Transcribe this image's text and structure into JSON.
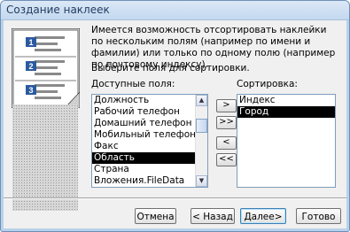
{
  "window": {
    "title": "Создание наклеек"
  },
  "description": "Имеется возможность отсортировать наклейки по нескольким полям (например по имени и фамилии) или только по одному полю (например по почтовому индексу).",
  "prompt": "Выберите поля для сортировки.",
  "available_fields": {
    "label": "Доступные поля:",
    "items": [
      "Должность",
      "Рабочий телефон",
      "Домашний телефон",
      "Мобильный телефон",
      "Факс",
      "Область",
      "Страна",
      "Вложения.FileData"
    ],
    "selected": "Область"
  },
  "sorting": {
    "label": "Сортировка:",
    "items": [
      "Индекс",
      "Город"
    ],
    "selected": "Город"
  },
  "move_buttons": {
    "add": ">",
    "add_all": ">>",
    "remove": "<",
    "remove_all": "<<"
  },
  "illustration": {
    "numbers": [
      "1",
      "2",
      "3"
    ]
  },
  "footer": {
    "cancel": "Отмена",
    "back": "< Назад",
    "next": "Далее>",
    "finish": "Готово"
  }
}
